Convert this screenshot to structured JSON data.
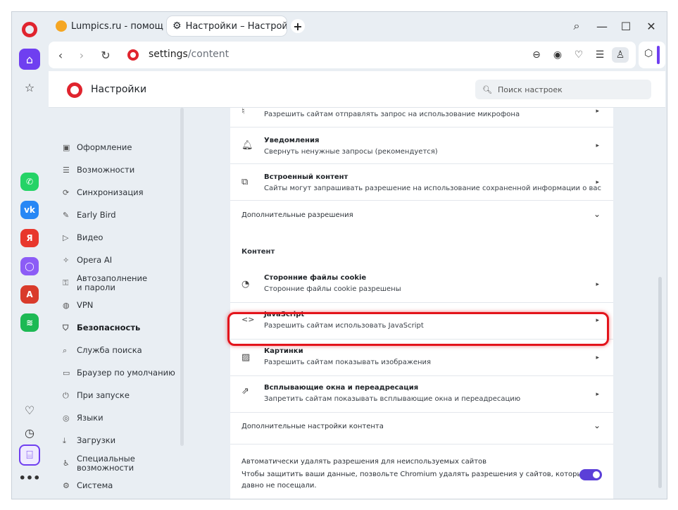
{
  "tabs": [
    {
      "title": "Lumpics.ru - помощь с ко",
      "favicon_color": "#f5a623"
    },
    {
      "title": "Настройки – Настройки с",
      "favicon": "gear-icon"
    }
  ],
  "newtab_label": "+",
  "window_controls": {
    "search": "⌕",
    "minimize": "—",
    "maximize": "☐",
    "close": "✕"
  },
  "address": {
    "host": "settings",
    "path": "/content"
  },
  "sidebar_apps": [
    {
      "name": "whatsapp-icon",
      "color": "#25d366",
      "glyph": "✆"
    },
    {
      "name": "vk-icon",
      "color": "#2787f5",
      "glyph": "vk"
    },
    {
      "name": "yandex-icon",
      "color": "#e8372c",
      "glyph": "Я"
    },
    {
      "name": "alice-icon",
      "color": "#8c5cf6",
      "glyph": "◯"
    },
    {
      "name": "translator-icon",
      "color": "#d93b2b",
      "glyph": "A"
    },
    {
      "name": "spotify-icon",
      "color": "#1db954",
      "glyph": "≋"
    }
  ],
  "header": {
    "title": "Настройки",
    "search_placeholder": "Поиск настроек"
  },
  "nav": [
    {
      "label": "Оформление",
      "icon": "▣"
    },
    {
      "label": "Возможности",
      "icon": "☰"
    },
    {
      "label": "Синхронизация",
      "icon": "⟳"
    },
    {
      "label": "Early Bird",
      "icon": "✎"
    },
    {
      "label": "Видео",
      "icon": "▷"
    },
    {
      "label": "Opera AI",
      "icon": "✧"
    },
    {
      "label": "Автозаполнение и пароли",
      "icon": "⚿"
    },
    {
      "label": "VPN",
      "icon": "◍"
    },
    {
      "label": "Безопасность",
      "icon": "⛉"
    },
    {
      "label": "Служба поиска",
      "icon": "⌕"
    },
    {
      "label": "Браузер по умолчанию",
      "icon": "▭"
    },
    {
      "label": "При запуске",
      "icon": "⏻"
    },
    {
      "label": "Языки",
      "icon": "◎"
    },
    {
      "label": "Загрузки",
      "icon": "⤓"
    },
    {
      "label": "Специальные возможности",
      "icon": "♿"
    },
    {
      "label": "Система",
      "icon": "⚙"
    }
  ],
  "content": {
    "mic_desc": "Разрешить сайтам отправлять запрос на использование микрофона",
    "notifications": {
      "title": "Уведомления",
      "desc": "Свернуть ненужные запросы (рекомендуется)"
    },
    "embedded": {
      "title": "Встроенный контент",
      "desc": "Сайты могут запрашивать разрешение на использование сохраненной информации о вас"
    },
    "additional_permissions": "Дополнительные разрешения",
    "section_content": "Контент",
    "cookies": {
      "title": "Сторонние файлы cookie",
      "desc": "Сторонние файлы cookie разрешены"
    },
    "javascript": {
      "title": "JavaScript",
      "desc": "Разрешить сайтам использовать JavaScript"
    },
    "images": {
      "title": "Картинки",
      "desc": "Разрешить сайтам показывать изображения"
    },
    "popups": {
      "title": "Всплывающие окна и переадресация",
      "desc": "Запретить сайтам показывать всплывающие окна и переадресацию"
    },
    "additional_content": "Дополнительные настройки контента",
    "auto_revoke": {
      "line1": "Автоматически удалять разрешения для неиспользуемых сайтов",
      "line2": "Чтобы защитить ваши данные, позвольте Chromium удалять разрешения у сайтов, которые вы",
      "line3": "давно не посещали.",
      "enabled": true
    }
  },
  "colors": {
    "accent": "#6f3ff0",
    "toggle": "#5b3fd8",
    "highlight": "#e3141b",
    "opera_red": "#e0242e"
  }
}
